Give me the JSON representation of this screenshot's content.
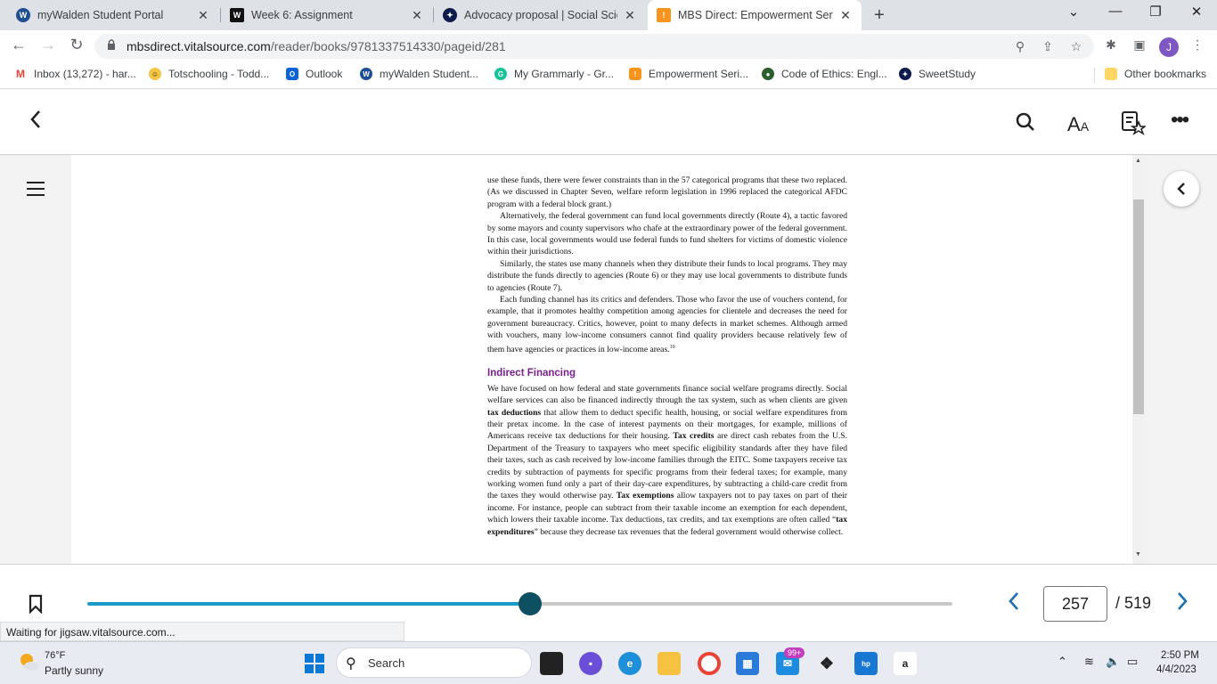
{
  "browser": {
    "tabs": [
      {
        "title": "myWalden Student Portal",
        "favicon": "walden-icon",
        "active": false
      },
      {
        "title": "Week 6: Assignment",
        "favicon": "w-icon",
        "active": false
      },
      {
        "title": "Advocacy proposal | Social Scienc",
        "favicon": "sweetstudy-icon",
        "active": false
      },
      {
        "title": "MBS Direct: Empowerment Series",
        "favicon": "mbs-icon",
        "active": true
      }
    ],
    "new_tab_label": "+",
    "url_domain": "mbsdirect.vitalsource.com",
    "url_path": "/reader/books/9781337514330/pageid/281",
    "profile_initial": "J",
    "bookmarks": [
      {
        "label": "Inbox (13,272) - har...",
        "icon": "gmail-icon"
      },
      {
        "label": "Totschooling - Todd...",
        "icon": "totschooling-icon"
      },
      {
        "label": "Outlook",
        "icon": "outlook-icon"
      },
      {
        "label": "myWalden Student...",
        "icon": "walden-icon"
      },
      {
        "label": "My Grammarly - Gr...",
        "icon": "grammarly-icon"
      },
      {
        "label": "Empowerment Seri...",
        "icon": "mbs-icon"
      },
      {
        "label": "Code of Ethics: Engl...",
        "icon": "nasw-icon"
      },
      {
        "label": "SweetStudy",
        "icon": "sweetstudy-icon"
      }
    ],
    "other_bookmarks": "Other bookmarks"
  },
  "reader": {
    "paragraphs_top": [
      "use these funds, there were fewer constraints than in the 57 categorical programs that these two replaced. (As we discussed in Chapter Seven, welfare reform legislation in 1996 replaced the categorical AFDC program with a federal block grant.)",
      "Alternatively, the federal government can fund local governments directly (Route 4), a tactic favored by some mayors and county supervisors who chafe at the extraordinary power of the federal government. In this case, local governments would use federal funds to fund shelters for victims of domestic violence within their jurisdictions.",
      "Similarly, the states use many channels when they distribute their funds to local programs. They may distribute the funds directly to agencies (Route 6) or they may use local governments to distribute funds to agencies (Route 7).",
      "Each funding channel has its critics and defenders. Those who favor the use of vouchers contend, for example, that it promotes healthy competition among agencies for clientele and decreases the need for government bureaucracy. Critics, however, point to many defects in market schemes. Although armed with vouchers, many low-income consumers cannot find quality providers because relatively few of them have agencies or practices in low-income areas."
    ],
    "footnote": "19",
    "heading": "Indirect Financing",
    "indirect": {
      "t1": "We have focused on how federal and state governments finance social welfare programs directly. Social welfare services can also be financed indirectly through the tax system, such as when clients are given ",
      "b1": "tax deductions",
      "t2": " that allow them to deduct specific health, housing, or social welfare expenditures from their pretax income. In the case of interest payments on their mortgages, for example, millions of Americans receive tax deductions for their housing. ",
      "b2": "Tax credits",
      "t3": " are direct cash rebates from the U.S. Department of the Treasury to taxpayers who meet specific eligibility standards after they have filed their taxes, such as cash received by low-income families through the EITC. Some taxpayers receive tax credits by subtraction of payments for specific programs from their federal taxes; for example, many working women fund only a part of their day-care expenditures, by subtracting a child-care credit from the taxes they would otherwise pay. ",
      "b3": "Tax exemptions",
      "t4": " allow taxpayers not to pay taxes on part of their income. For instance, people can subtract from their taxable income an exemption for each dependent, which lowers their taxable income. Tax deductions, tax credits, and tax exemptions are often called “",
      "b4": "tax expenditures",
      "t5": "” because they decrease tax revenues that the federal government would otherwise collect."
    },
    "current_page": "257",
    "total_pages": "/ 519",
    "progress_fraction": 0.512
  },
  "status_text": "Waiting for jigsaw.vitalsource.com...",
  "taskbar": {
    "weather_temp": "76°F",
    "weather_cond": "Partly sunny",
    "search_placeholder": "Search",
    "mail_badge": "99+",
    "time": "2:50 PM",
    "date": "4/4/2023"
  },
  "colors": {
    "heading": "#7b1f8f",
    "progress": "#1a9bc7",
    "knob": "#0e4f62",
    "page_nav": "#1a6fb5"
  }
}
